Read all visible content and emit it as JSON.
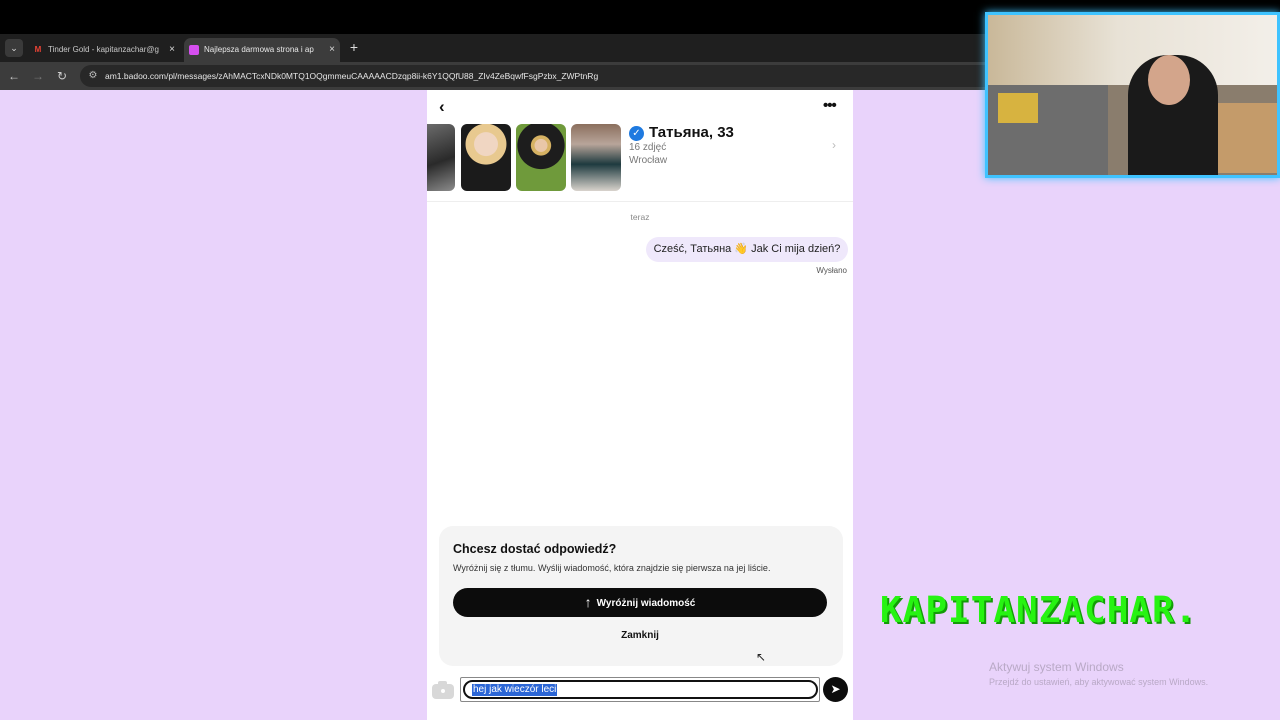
{
  "browser": {
    "tabs": [
      {
        "title": "Tinder Gold - kapitanzachar@g",
        "favicon": "gmail-icon",
        "active": false
      },
      {
        "title": "Najlepsza darmowa strona i ap",
        "favicon": "badoo-icon",
        "active": true
      }
    ],
    "tab_menu_icon": "⌄",
    "new_tab_icon": "+",
    "close_glyph": "×",
    "back_glyph": "←",
    "forward_glyph": "→",
    "reload_glyph": "↻",
    "site_info_glyph": "⚙",
    "url": "am1.badoo.com/pl/messages/zAhMACTcxNDk0MTQ1OQgmmeuCAAAAACDzqp8ii-k6Y1QQfU88_ZIv4ZeBqwfFsgPzbx_ZWPtnRg"
  },
  "chat": {
    "back_glyph": "‹",
    "more_glyph": "•••",
    "profile": {
      "name": "Татьяна, 33",
      "photos": "16 zdjęć",
      "city": "Wrocław",
      "verified_glyph": "✓",
      "arrow_glyph": "›"
    },
    "time_label": "teraz",
    "messages": [
      {
        "text": "Cześć, Татьяна 👋 Jak Ci mija dzień?",
        "status": "Wysłano"
      }
    ],
    "promo": {
      "title": "Chcesz dostać odpowiedź?",
      "description": "Wyróżnij się z tłumu. Wyślij wiadomość, która znajdzie się pierwsza na jej liście.",
      "button_label": "Wyróżnij wiadomość",
      "button_arrow": "↑",
      "close_label": "Zamknij"
    },
    "composer": {
      "value": "hej jak wieczór leci",
      "send_glyph": "➤"
    }
  },
  "overlay": {
    "watermark": "KAPITANZACHAR.",
    "windows_title": "Aktywuj system Windows",
    "windows_subtitle": "Przejdź do ustawień, aby aktywować system Windows."
  },
  "colors": {
    "page_background": "#e9d3fb",
    "bubble": "#efe8fb",
    "verified": "#1f7ae0",
    "watermark": "#27f312",
    "webcam_border": "#3fc3ff"
  }
}
